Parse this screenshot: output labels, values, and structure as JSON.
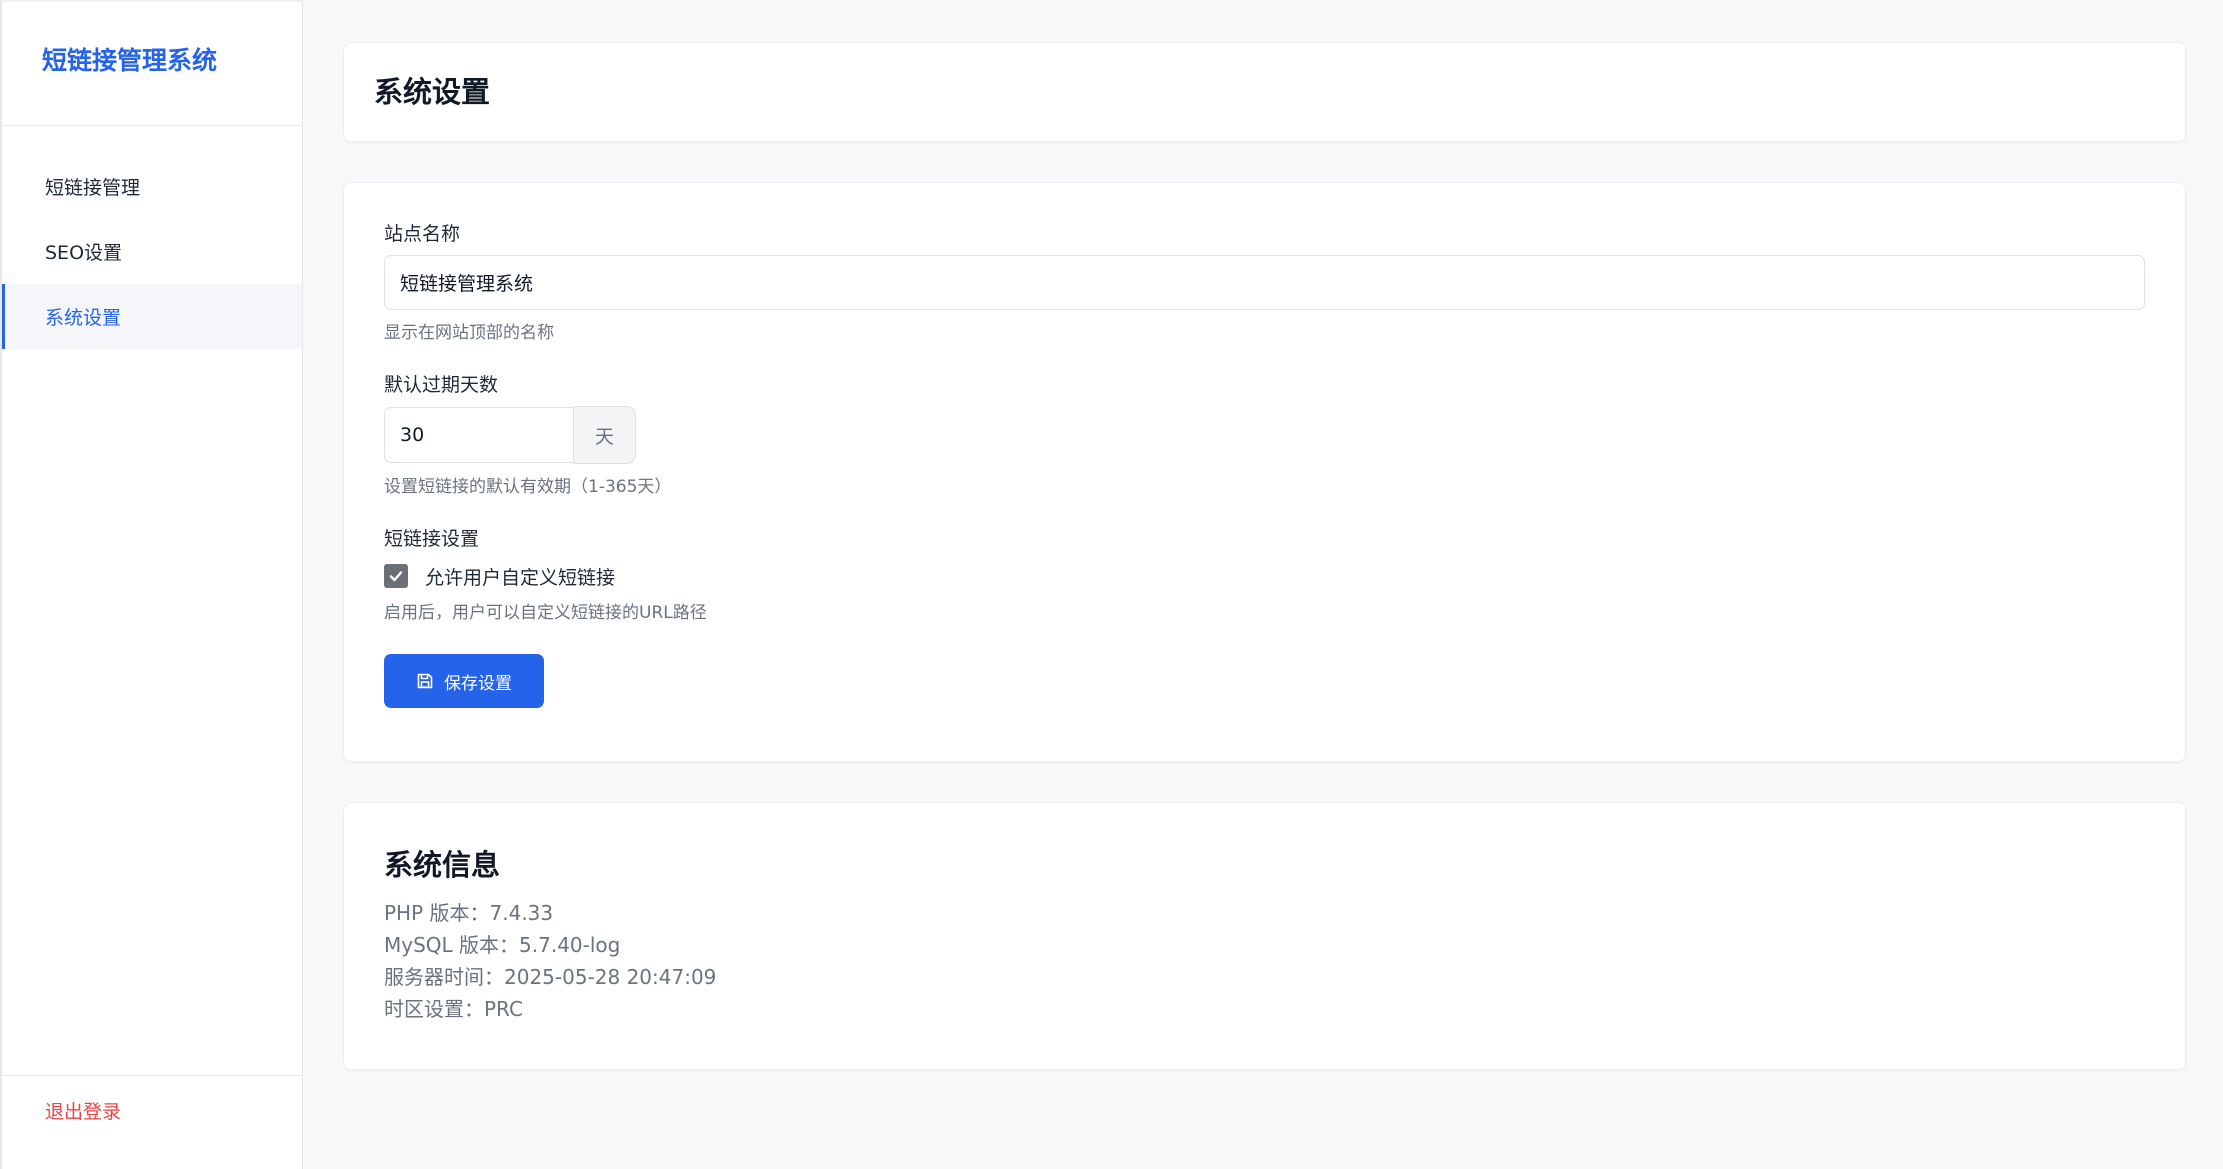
{
  "sidebar": {
    "brand": "短链接管理系统",
    "items": [
      {
        "label": "短链接管理"
      },
      {
        "label": "SEO设置"
      },
      {
        "label": "系统设置"
      }
    ],
    "logout": "退出登录"
  },
  "header": {
    "title": "系统设置"
  },
  "form": {
    "site_name": {
      "label": "站点名称",
      "value": "短链接管理系统",
      "help": "显示在网站顶部的名称"
    },
    "expire_days": {
      "label": "默认过期天数",
      "value": "30",
      "unit": "天",
      "help": "设置短链接的默认有效期（1-365天）"
    },
    "shortlink": {
      "label": "短链接设置",
      "checkbox_label": "允许用户自定义短链接",
      "checked": true,
      "help": "启用后，用户可以自定义短链接的URL路径"
    },
    "save_label": "保存设置"
  },
  "info": {
    "title": "系统信息",
    "lines": [
      "PHP 版本：7.4.33",
      "MySQL 版本：5.7.40-log",
      "服务器时间：2025-05-28 20:47:09",
      "时区设置：PRC"
    ]
  },
  "colors": {
    "accent": "#2563eb",
    "danger": "#ef4444",
    "background": "#f7f8fa"
  },
  "icons": {
    "save": "save-icon",
    "check": "check-icon"
  }
}
